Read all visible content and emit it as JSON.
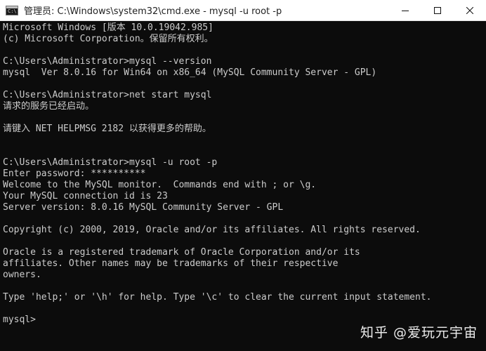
{
  "window": {
    "title": "管理员: C:\\Windows\\system32\\cmd.exe - mysql  -u root -p",
    "controls": {
      "minimize_icon": "minimize-icon",
      "maximize_icon": "maximize-icon",
      "close_icon": "close-icon"
    },
    "colors": {
      "console_bg": "#0c0c0c",
      "console_fg": "#cccccc",
      "titlebar_bg": "#ffffff"
    }
  },
  "console": {
    "lines": [
      "Microsoft Windows [版本 10.0.19042.985]",
      "(c) Microsoft Corporation。保留所有权利。",
      "",
      "C:\\Users\\Administrator>mysql --version",
      "mysql  Ver 8.0.16 for Win64 on x86_64 (MySQL Community Server - GPL)",
      "",
      "C:\\Users\\Administrator>net start mysql",
      "请求的服务已经启动。",
      "",
      "请键入 NET HELPMSG 2182 以获得更多的帮助。",
      "",
      "",
      "C:\\Users\\Administrator>mysql -u root -p",
      "Enter password: **********",
      "Welcome to the MySQL monitor.  Commands end with ; or \\g.",
      "Your MySQL connection id is 23",
      "Server version: 8.0.16 MySQL Community Server - GPL",
      "",
      "Copyright (c) 2000, 2019, Oracle and/or its affiliates. All rights reserved.",
      "",
      "Oracle is a registered trademark of Oracle Corporation and/or its",
      "affiliates. Other names may be trademarks of their respective",
      "owners.",
      "",
      "Type 'help;' or '\\h' for help. Type '\\c' to clear the current input statement.",
      "",
      "mysql>"
    ]
  },
  "watermark": {
    "text": "知乎 @爱玩元宇宙"
  }
}
